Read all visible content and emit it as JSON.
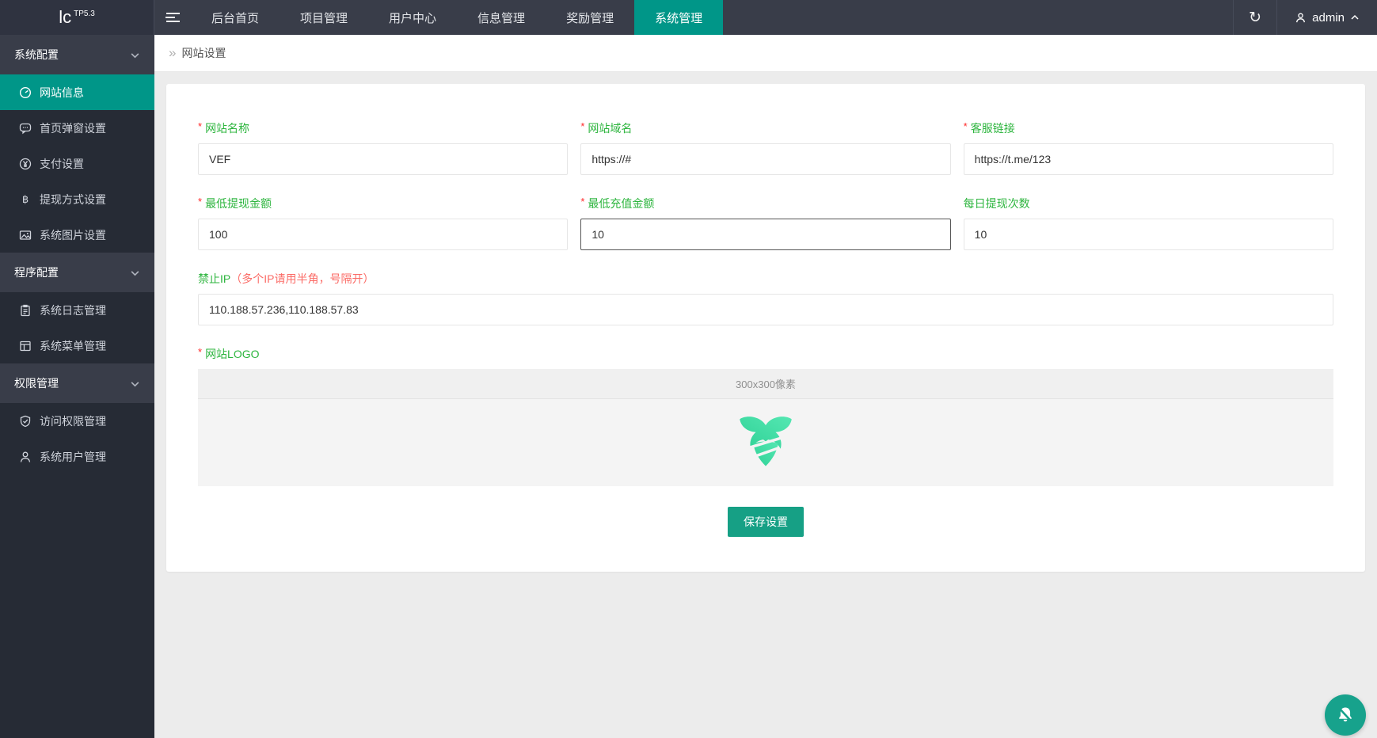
{
  "topbar": {
    "logo": "lc",
    "logo_sup": "TP5.3",
    "nav": [
      {
        "label": "后台首页"
      },
      {
        "label": "项目管理"
      },
      {
        "label": "用户中心"
      },
      {
        "label": "信息管理"
      },
      {
        "label": "奖励管理"
      },
      {
        "label": "系统管理"
      }
    ],
    "username": "admin"
  },
  "sidebar": {
    "sections": [
      {
        "label": "系统配置",
        "items": [
          {
            "icon": "gauge-icon",
            "label": "网站信息"
          },
          {
            "icon": "popup-icon",
            "label": "首页弹窗设置"
          },
          {
            "icon": "yen-icon",
            "label": "支付设置"
          },
          {
            "icon": "bitcoin-icon",
            "label": "提现方式设置"
          },
          {
            "icon": "image-icon",
            "label": "系统图片设置"
          }
        ]
      },
      {
        "label": "程序配置",
        "items": [
          {
            "icon": "log-icon",
            "label": "系统日志管理"
          },
          {
            "icon": "menu-icon",
            "label": "系统菜单管理"
          }
        ]
      },
      {
        "label": "权限管理",
        "items": [
          {
            "icon": "shield-icon",
            "label": "访问权限管理"
          },
          {
            "icon": "user-icon",
            "label": "系统用户管理"
          }
        ]
      }
    ]
  },
  "breadcrumb": {
    "current": "网站设置"
  },
  "form": {
    "fields": [
      {
        "label": "网站名称",
        "required": true,
        "value": "VEF"
      },
      {
        "label": "网站域名",
        "required": true,
        "value": "https://#"
      },
      {
        "label": "客服链接",
        "required": true,
        "value": "https://t.me/123"
      },
      {
        "label": "最低提现金额",
        "required": true,
        "value": "100"
      },
      {
        "label": "最低充值金额",
        "required": true,
        "value": "10",
        "focused": true
      },
      {
        "label": "每日提现次数",
        "required": false,
        "value": "10"
      }
    ],
    "ip_field": {
      "label": "禁止IP",
      "hint": "（多个IP请用半角，号隔开）",
      "value": "110.188.57.236,110.188.57.83"
    },
    "logo_field": {
      "label": "网站LOGO",
      "size_hint": "300x300像素"
    },
    "save_label": "保存设置"
  },
  "colors": {
    "topbar_bg": "#393D49",
    "sidebar_bg": "#262B35",
    "accent_teal": "#009688",
    "save_button": "#16A085",
    "label_green": "#2DB53E",
    "required_red": "#FF2A2A",
    "hint_red": "#FB6B66",
    "logo_bull_green": "#3CDC9C"
  }
}
